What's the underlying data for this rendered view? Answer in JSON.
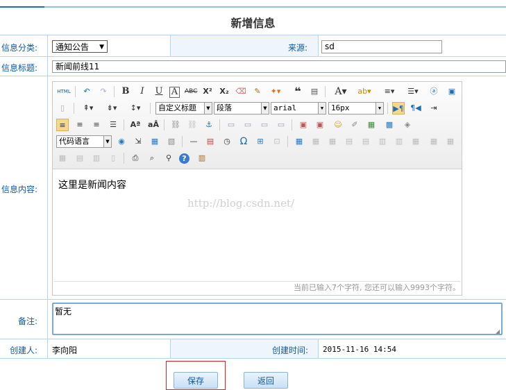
{
  "page": {
    "title": "新增信息"
  },
  "form": {
    "category_label": "信息分类:",
    "category_value": "通知公告",
    "source_label": "来源:",
    "source_value": "sd",
    "title_label": "信息标题:",
    "title_value": "新闻前线11",
    "content_label": "信息内容:",
    "remark_label": "备注:",
    "remark_value": "暂无",
    "creator_label": "创建人:",
    "creator_value": "李向阳",
    "created_time_label": "创建时间:",
    "created_time_value": "2015-11-16 14:54"
  },
  "editor": {
    "content": "这里是新闻内容",
    "watermark": "http://blog.csdn.net/",
    "status": "当前已输入7个字符, 您还可以输入9993个字符。",
    "custom_title_select": "自定义标题",
    "paragraph_select": "段落",
    "font_select": "arial",
    "size_select": "16px",
    "code_lang_select": "代码语言",
    "html_button": "HTML"
  },
  "buttons": {
    "save": "保存",
    "back": "返回"
  }
}
